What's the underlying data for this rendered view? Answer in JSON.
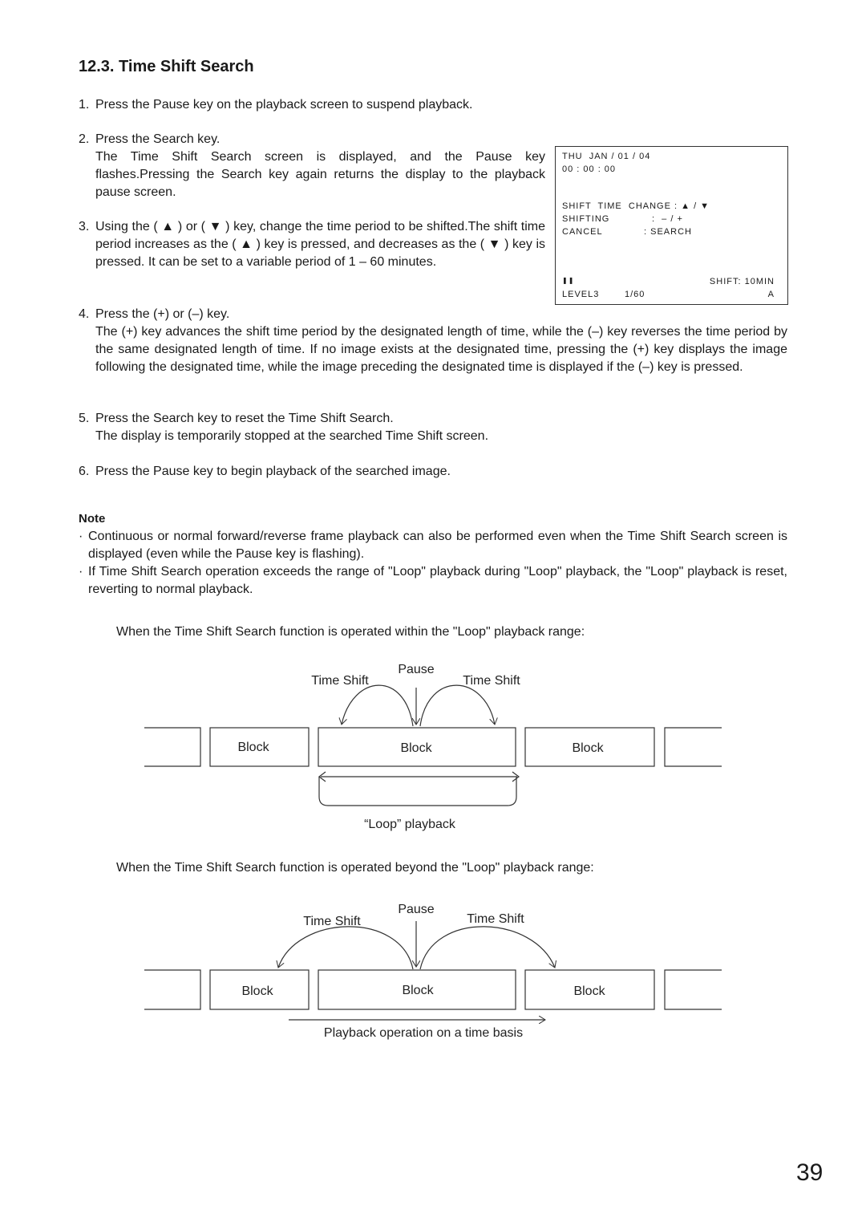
{
  "section_title": "12.3. Time Shift Search",
  "steps": [
    {
      "num": "1.",
      "lines": [
        "Press the Pause key on the playback screen to suspend playback."
      ]
    },
    {
      "num": "2.",
      "lead": "Press the Search key.",
      "body": "The Time Shift Search screen is displayed, and the Pause key flashes.Pressing the Search key again returns the display to the playback pause screen."
    },
    {
      "num": "3.",
      "body": "Using the ( ▲ ) or ( ▼ ) key, change the time period to be shifted.The shift time period increases as the ( ▲ ) key is pressed, and decreases as the ( ▼ ) key is pressed. It can be set to a variable period of 1 – 60 minutes."
    },
    {
      "num": "4.",
      "lead": "Press the (+) or (–) key.",
      "body": "The (+) key advances the shift time period by the designated length of time, while the (–) key reverses the time period by the same designated length of time. If no image exists at the designated time, pressing the (+) key displays the image following the designated time, while the image preceding the designated time is displayed if the (–) key is pressed."
    },
    {
      "num": "5.",
      "lead": "Press the Search key to reset the Time Shift Search.",
      "body": "The display is temporarily stopped at the searched Time Shift screen."
    },
    {
      "num": "6.",
      "lead": "Press the Pause key to begin playback of the searched image."
    }
  ],
  "screen": {
    "date": "THU  JAN / 01 / 04",
    "time": "00 : 00 : 00",
    "menu": [
      {
        "label": "SHIFT  TIME  CHANGE",
        "value": ": ▲ / ▼"
      },
      {
        "label": "SHIFTING",
        "value": ":  – / +"
      },
      {
        "label": "CANCEL",
        "value": ": SEARCH"
      }
    ],
    "pause_icon": "❚❚",
    "shift": "SHIFT: 10MIN",
    "level": "LEVEL3",
    "page": "1/60",
    "camera": "A"
  },
  "note": {
    "heading": "Note",
    "bullets": [
      "Continuous or normal forward/reverse frame playback can also be performed even when the Time Shift Search screen is displayed (even while the Pause key is flashing).",
      "If Time Shift Search operation exceeds the range of \"Loop\" playback during \"Loop\" playback, the \"Loop\" playback is reset, reverting to normal playback."
    ]
  },
  "diagram1": {
    "intro": "When the Time Shift Search function is operated within the \"Loop\" playback range:",
    "pause": "Pause",
    "shift_left": "Time Shift",
    "shift_right": "Time Shift",
    "blocks": [
      "Block",
      "Block",
      "Block"
    ],
    "caption": "“Loop” playback"
  },
  "diagram2": {
    "intro": "When the Time Shift Search function is operated beyond the \"Loop\" playback range:",
    "pause": "Pause",
    "shift_left": "Time Shift",
    "shift_right": "Time Shift",
    "blocks": [
      "Block",
      "Block",
      "Block"
    ],
    "caption": "Playback operation on a time basis"
  },
  "page_number": "39"
}
